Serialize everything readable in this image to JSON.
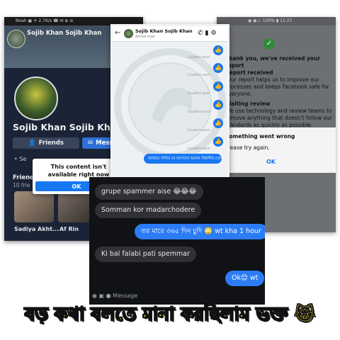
{
  "left_screen": {
    "status_text": "Noah ▣ ☀ 2.7K/s ☎ ✉ ⊕ ⊖",
    "top_name": "Sojib Khan Sojib Khan",
    "profile_name": "Sojib Khan Sojib Khan",
    "friends_button": "Friends",
    "message_button": "Messag",
    "dim_row_text": "Se",
    "friends_heading": "Friend",
    "friends_count": "10 frie",
    "friend_names": [
      "Sadiya Akht...",
      "Af Rin"
    ],
    "dialog_text": "This content isn't available right now",
    "dialog_ok": "OK"
  },
  "right_screen": {
    "status_text": "◉ ◉ ▷ 100% ▮ 11:27",
    "thanks": "Thank you, we've received your report",
    "received_title": "Report received",
    "received_body": "Your report helps us to improve our processes and keeps Facebook safe for everyone.",
    "waiting_title": "Waiting review",
    "waiting_body": "We use technology and review teams to remove anything that doesn't follow our standards as quickly as possible.",
    "error_title": "Something went wrong",
    "error_body": "Please try again.",
    "ok": "OK"
  },
  "messenger": {
    "name": "Sojib Khan Sojib Khan",
    "status": "Active now",
    "couldnt_send": "Couldn't send",
    "sent_text": "আহারে পানির যে আপদান অনেক বিশ্বাসীর তোমা আবাসু 😂"
  },
  "chat": {
    "incoming_1": "grupe spammer aise 😂😂😂",
    "incoming_2": "Somman kor madarchodere",
    "outgoing_1": "তর মারে ৩৬৫ দিন চুদি 🙄  wt kha 1 hour",
    "incoming_3": "Ki bal falabi pati spemmar",
    "outgoing_2": "Ok😊 wt",
    "composer_placeholder": "Message"
  },
  "caption": "বড় কথা বলতে মানা করছিলাম ভক্ত 😹",
  "colors": {
    "messenger_blue": "#1877f2",
    "caption_yellow": "#ffe21a",
    "chat_dark": "#111215"
  }
}
